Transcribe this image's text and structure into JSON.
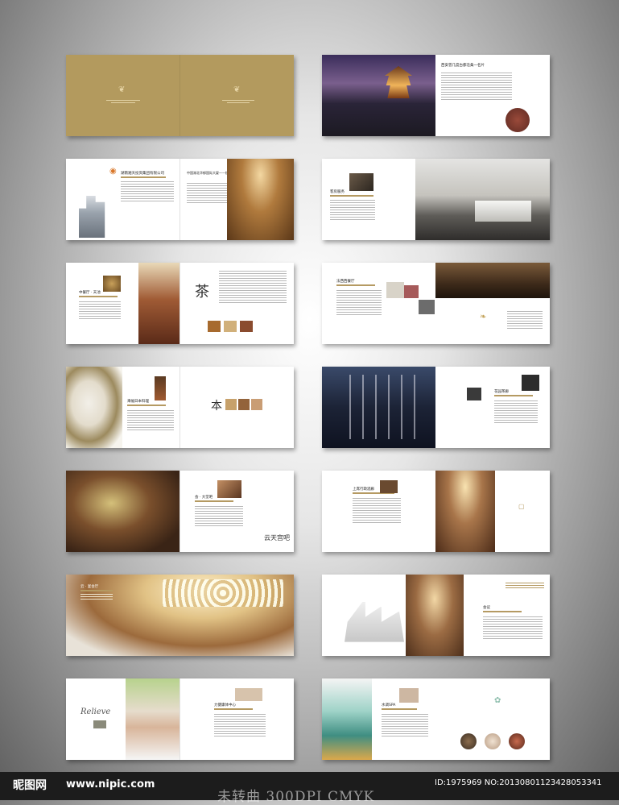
{
  "footer": {
    "brand": "昵图网",
    "domain": "www.nipic.com",
    "watermark": "未转曲  300DPI  CMYK",
    "image_id": "ID:1975969 NO:20130801123428053341"
  },
  "spreads": {
    "s2": {
      "heading": "西安曾几度古都沧桑一名片"
    },
    "s3": {
      "heading_left": "湖南湘天投资集团有限公司",
      "heading_right": "中国湖北华郁国际大厦——楼中国际酒店"
    },
    "s4": {
      "heading": "客房服务"
    },
    "s5": {
      "heading": "中餐厅 · 天池"
    },
    "s6": {
      "heading": "法西西餐厅"
    },
    "s7": {
      "heading": "来幅日本料理"
    },
    "s8": {
      "heading": "花园茶廊"
    },
    "s9": {
      "heading": "会 · 大堂吧"
    },
    "s10": {
      "heading": "上席行政酒廊"
    },
    "s11": {
      "heading": "云 · 宴会厅"
    },
    "s12": {
      "heading": "会议"
    },
    "s13": {
      "heading": "力健康体中心",
      "script_word": "Relieve"
    },
    "s14": {
      "heading": "水调SPA"
    }
  },
  "colors": {
    "gold": "#b59a62",
    "cover": "#b39a5e"
  }
}
